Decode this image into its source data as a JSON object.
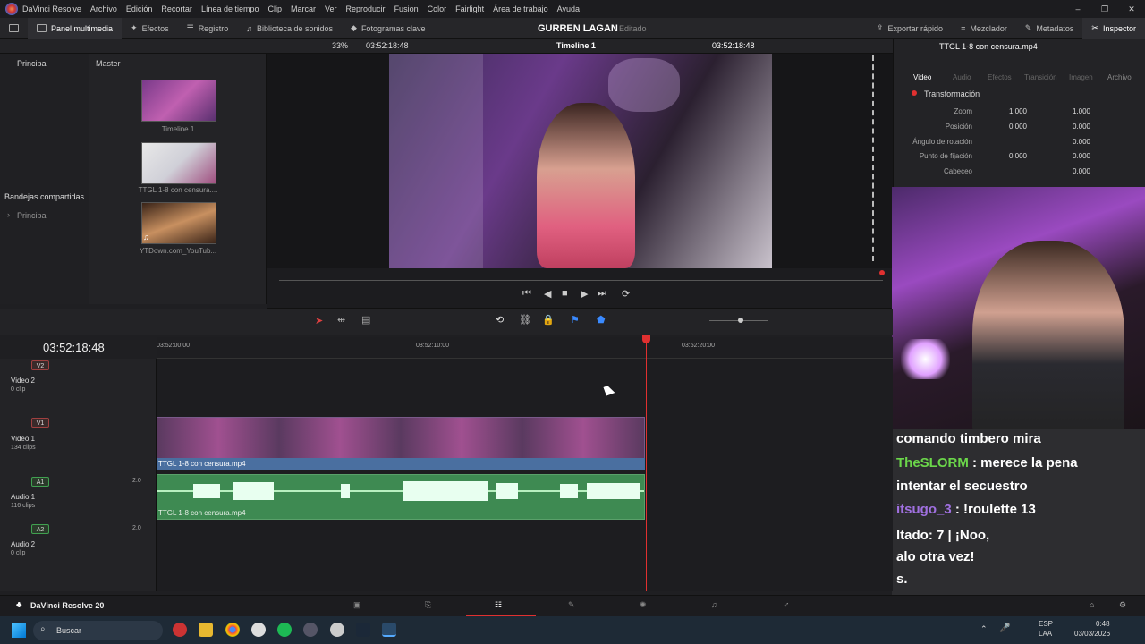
{
  "menubar": {
    "app_name": "DaVinci Resolve",
    "items": [
      "Archivo",
      "Edición",
      "Recortar",
      "Línea de tiempo",
      "Clip",
      "Marcar",
      "Ver",
      "Reproducir",
      "Fusion",
      "Color",
      "Fairlight",
      "Área de trabajo",
      "Ayuda"
    ]
  },
  "toolbar": {
    "media_pool": "Panel multimedia",
    "effects": "Efectos",
    "edit_index": "Registro",
    "sound_library": "Biblioteca de sonidos",
    "keyframes": "Fotogramas clave",
    "project_title": "GURREN LAGAN",
    "project_status": "Editado",
    "quick_export": "Exportar rápido",
    "mixer": "Mezclador",
    "metadata": "Metadatos",
    "inspector": "Inspector"
  },
  "viewer": {
    "zoom": "33%",
    "source_timecode": "03:52:18:48",
    "timeline_name": "Timeline 1",
    "timeline_timecode": "03:52:18:48",
    "clip_name": "TTGL 1-8 con censura.mp4"
  },
  "left_pane": {
    "principal": "Principal",
    "shared_bins": "Bandejas compartidas",
    "shared_principal": "Principal"
  },
  "media_pool": {
    "master": "Master",
    "items": [
      {
        "label": "Timeline 1"
      },
      {
        "label": "TTGL 1-8 con censura...."
      },
      {
        "label": "YTDown.com_YouTub..."
      }
    ]
  },
  "inspector": {
    "tabs": [
      "Video",
      "Audio",
      "Efectos",
      "Transición",
      "Imagen",
      "Archivo"
    ],
    "section": "Transformación",
    "rows": [
      {
        "label": "Zoom",
        "x": "1.000",
        "y": "1.000"
      },
      {
        "label": "Posición",
        "x": "0.000",
        "y": "0.000"
      },
      {
        "label": "Ángulo de rotación",
        "y": "0.000"
      },
      {
        "label": "Punto de fijación",
        "x": "0.000",
        "y": "0.000"
      },
      {
        "label": "Cabeceo",
        "y": "0.000"
      }
    ]
  },
  "timeline": {
    "timecode": "03:52:18:48",
    "ruler": [
      "03:52:00:00",
      "03:52:10:00",
      "03:52:20:00"
    ],
    "tracks": [
      {
        "badge": "V2",
        "name": "Video 2",
        "sub": "0 clip"
      },
      {
        "badge": "V1",
        "name": "Video 1",
        "sub": "134 clips"
      },
      {
        "badge": "A1",
        "name": "Audio 1",
        "sub": "116 clips",
        "vol": "2.0"
      },
      {
        "badge": "A2",
        "name": "Audio 2",
        "sub": "0 clip",
        "vol": "2.0"
      }
    ],
    "v1_clip": "TTGL 1-8 con censura.mp4",
    "a1_clip": "TTGL 1-8 con censura.mp4"
  },
  "chat": {
    "lines": [
      {
        "user": "",
        "text": "comando timbero mira"
      },
      {
        "user": "TheSLORM",
        "text": " : merece la pena",
        "user_color": "#6bd64a"
      },
      {
        "user": "",
        "text": "intentar el secuestro"
      },
      {
        "user": "itsugo_3",
        "text": " : !roulette 13",
        "user_color": "#a070e0"
      },
      {
        "user": "",
        "text": "ltado: 7 | ¡Noo,"
      },
      {
        "user": "",
        "text": "alo otra vez! "
      },
      {
        "user": "",
        "text": "s."
      }
    ]
  },
  "bottom": {
    "app_version": "DaVinci Resolve 20"
  },
  "taskbar": {
    "search": "Buscar",
    "lang": "ESP",
    "lang2": "LAA",
    "time": "0:48",
    "date": "03/03/2026"
  },
  "colors": {
    "playhead": "#e03030",
    "video_clip": "#4a6fa0",
    "audio_clip": "#3e8a52"
  }
}
